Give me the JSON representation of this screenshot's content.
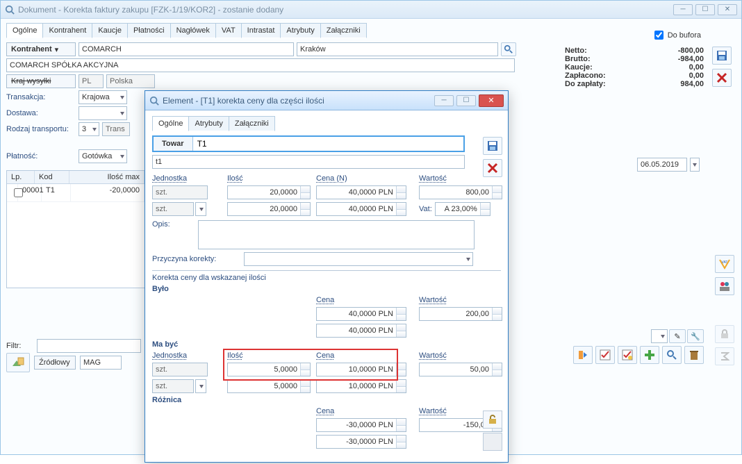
{
  "main": {
    "title": "Dokument - Korekta faktury zakupu [FZK-1/19/KOR2]  - zostanie dodany",
    "do_bufora": "Do bufora",
    "tabs": [
      "Ogólne",
      "Kontrahent",
      "Kaucje",
      "Płatności",
      "Nagłówek",
      "VAT",
      "Intrastat",
      "Atrybuty",
      "Załączniki"
    ],
    "kontrahent_btn": "Kontrahent",
    "kontrahent_code": "COMARCH",
    "kontrahent_city": "Kraków",
    "kontrahent_full": "COMARCH SPÓŁKA AKCYJNA",
    "kraj_wysylki_btn": "Kraj wysyłki",
    "kraj_code": "PL",
    "kraj_name": "Polska",
    "transakcja_lbl": "Transakcja:",
    "transakcja_val": "Krajowa",
    "dostawa_lbl": "Dostawa:",
    "rodzaj_lbl": "Rodzaj transportu:",
    "rodzaj_val": "3",
    "rodzaj_txt": "Trans",
    "platnosc_lbl": "Płatność:",
    "platnosc_val": "Gotówka",
    "filtr_lbl": "Filtr:",
    "zrodlowy_btn": "Źródłowy",
    "mag_val": "MAG",
    "date": "06.05.2019",
    "totals": {
      "netto_lbl": "Netto:",
      "netto_val": "-800,00",
      "brutto_lbl": "Brutto:",
      "brutto_val": "-984,00",
      "kaucje_lbl": "Kaucje:",
      "kaucje_val": "0,00",
      "zapl_lbl": "Zapłacono:",
      "zapl_val": "0,00",
      "dozap_lbl": "Do zapłaty:",
      "dozap_val": "984,00"
    },
    "grid": {
      "h_lp": "Lp.",
      "h_kod": "Kod",
      "h_ilosc": "Ilość max",
      "r1_lp": "00001",
      "r1_kod": "T1",
      "r1_ilosc": "-20,0000"
    }
  },
  "dlg": {
    "title": "Element - [T1] korekta ceny dla części ilości",
    "tabs": [
      "Ogólne",
      "Atrybuty",
      "Załączniki"
    ],
    "towar_btn": "Towar",
    "towar_val": "T1",
    "towar_sub": "t1",
    "hdr": {
      "jedn": "Jednostka",
      "ilosc": "Ilość",
      "cena": "Cena (N)",
      "wart": "Wartość"
    },
    "row1": {
      "jedn": "szt.",
      "ilosc": "20,0000",
      "cena": "40,0000 PLN",
      "wart": "800,00"
    },
    "row2": {
      "jedn": "szt.",
      "ilosc": "20,0000",
      "cena": "40,0000 PLN",
      "vat_lbl": "Vat:",
      "vat": "A 23,00%"
    },
    "opis_lbl": "Opis:",
    "przyczyna_lbl": "Przyczyna korekty:",
    "section": "Korekta ceny dla wskazanej ilości",
    "bylo": "Było",
    "bylo_cena_lbl": "Cena",
    "bylo_wart_lbl": "Wartość",
    "bylo_cena1": "40,0000 PLN",
    "bylo_wart1": "200,00",
    "bylo_cena2": "40,0000 PLN",
    "mabyc": "Ma być",
    "mb_jedn_lbl": "Jednostka",
    "mb_ilosc_lbl": "Ilość",
    "mb_cena_lbl": "Cena",
    "mb_wart_lbl": "Wartość",
    "mb_r1": {
      "jedn": "szt.",
      "ilosc": "5,0000",
      "cena": "10,0000 PLN",
      "wart": "50,00"
    },
    "mb_r2": {
      "jedn": "szt.",
      "ilosc": "5,0000",
      "cena": "10,0000 PLN"
    },
    "roznica": "Różnica",
    "rz_cena_lbl": "Cena",
    "rz_wart_lbl": "Wartość",
    "rz_cena1": "-30,0000 PLN",
    "rz_wart1": "-150,00",
    "rz_cena2": "-30,0000 PLN"
  }
}
